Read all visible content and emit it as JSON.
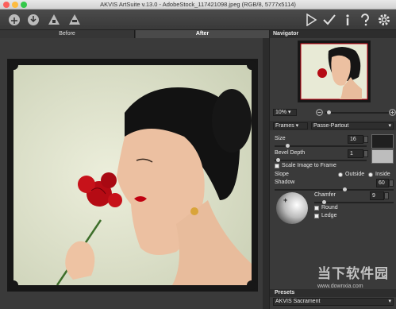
{
  "window": {
    "title": "AKVIS ArtSuite v.13.0 - AdobeStock_117421098.jpeg (RGB/8, 5777x5114)"
  },
  "toolbar": {
    "left": [
      {
        "icon": "open-image-icon"
      },
      {
        "icon": "save-image-icon"
      },
      {
        "icon": "batch-processing-icon"
      },
      {
        "icon": "print-icon"
      }
    ],
    "right": [
      {
        "icon": "run-icon"
      },
      {
        "icon": "apply-icon"
      },
      {
        "icon": "info-icon"
      },
      {
        "icon": "help-icon"
      },
      {
        "icon": "settings-icon"
      }
    ]
  },
  "view_tabs": {
    "before": "Before",
    "after": "After"
  },
  "navigator": {
    "title": "Navigator",
    "zoom": "10%"
  },
  "effect": {
    "category": "Frames",
    "type": "Passe-Partout"
  },
  "settings": {
    "size_label": "Size",
    "size_value": "16",
    "bevel_label": "Bevel Depth",
    "bevel_value": "1",
    "scale_label": "Scale Image to Frame",
    "slope_label": "Slope",
    "outside_label": "Outside",
    "inside_label": "Inside",
    "shadow_label": "Shadow",
    "shadow_value": "60",
    "chamfer_label": "Chamfer",
    "chamfer_value": "9",
    "round_label": "Round",
    "ledge_label": "Ledge"
  },
  "presets": {
    "title": "Presets",
    "selected": "AKVIS Sacrament"
  },
  "watermark": {
    "text": "当下软件园",
    "url": "www.downxia.com"
  },
  "colors": {
    "frame": "#171717",
    "swatch_dark": "#1f1f1f",
    "swatch_light": "#bdbdbd",
    "lip": "#c00010"
  }
}
